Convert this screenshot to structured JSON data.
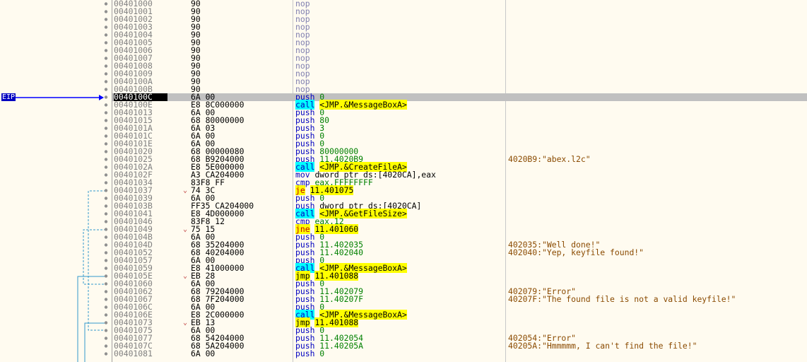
{
  "eip_label": "EIP",
  "rows": [
    {
      "addr": "00401000",
      "bytes": "90",
      "mn": "nop",
      "op": "",
      "cmt": ""
    },
    {
      "addr": "00401001",
      "bytes": "90",
      "mn": "nop",
      "op": "",
      "cmt": ""
    },
    {
      "addr": "00401002",
      "bytes": "90",
      "mn": "nop",
      "op": "",
      "cmt": ""
    },
    {
      "addr": "00401003",
      "bytes": "90",
      "mn": "nop",
      "op": "",
      "cmt": ""
    },
    {
      "addr": "00401004",
      "bytes": "90",
      "mn": "nop",
      "op": "",
      "cmt": ""
    },
    {
      "addr": "00401005",
      "bytes": "90",
      "mn": "nop",
      "op": "",
      "cmt": ""
    },
    {
      "addr": "00401006",
      "bytes": "90",
      "mn": "nop",
      "op": "",
      "cmt": ""
    },
    {
      "addr": "00401007",
      "bytes": "90",
      "mn": "nop",
      "op": "",
      "cmt": ""
    },
    {
      "addr": "00401008",
      "bytes": "90",
      "mn": "nop",
      "op": "",
      "cmt": ""
    },
    {
      "addr": "00401009",
      "bytes": "90",
      "mn": "nop",
      "op": "",
      "cmt": ""
    },
    {
      "addr": "0040100A",
      "bytes": "90",
      "mn": "nop",
      "op": "",
      "cmt": ""
    },
    {
      "addr": "0040100B",
      "bytes": "90",
      "mn": "nop",
      "op": "",
      "cmt": ""
    },
    {
      "addr": "0040100C",
      "bytes": "6A 00",
      "mn": "push",
      "op": "0",
      "cmt": "",
      "eip": true
    },
    {
      "addr": "0040100E",
      "bytes": "E8 8C000000",
      "mn": "call",
      "op": "<JMP.&MessageBoxA>",
      "cmt": "",
      "kind": "call"
    },
    {
      "addr": "00401013",
      "bytes": "6A 00",
      "mn": "push",
      "op": "0",
      "cmt": ""
    },
    {
      "addr": "00401015",
      "bytes": "68 80000000",
      "mn": "push",
      "op": "80",
      "cmt": ""
    },
    {
      "addr": "0040101A",
      "bytes": "6A 03",
      "mn": "push",
      "op": "3",
      "cmt": ""
    },
    {
      "addr": "0040101C",
      "bytes": "6A 00",
      "mn": "push",
      "op": "0",
      "cmt": ""
    },
    {
      "addr": "0040101E",
      "bytes": "6A 00",
      "mn": "push",
      "op": "0",
      "cmt": ""
    },
    {
      "addr": "00401020",
      "bytes": "68 00000080",
      "mn": "push",
      "op": "80000000",
      "cmt": ""
    },
    {
      "addr": "00401025",
      "bytes": "68 B9204000",
      "mn": "push",
      "op": "11.4020B9",
      "cmt": "4020B9:\"abex.l2c\""
    },
    {
      "addr": "0040102A",
      "bytes": "E8 5E000000",
      "mn": "call",
      "op": "<JMP.&CreateFileA>",
      "cmt": "",
      "kind": "call"
    },
    {
      "addr": "0040102F",
      "bytes": "A3 CA204000",
      "mn": "mov",
      "op": "dword ptr ds:[4020CA],eax",
      "cmt": "",
      "kind": "mov"
    },
    {
      "addr": "00401034",
      "bytes": "83F8 FF",
      "mn": "cmp",
      "op": "eax,FFFFFFFF",
      "cmt": ""
    },
    {
      "addr": "00401037",
      "bytes": "74 3C",
      "mn": "je",
      "op": "11.401075",
      "cmt": "",
      "kind": "jcc",
      "arrow": "⌄"
    },
    {
      "addr": "00401039",
      "bytes": "6A 00",
      "mn": "push",
      "op": "0",
      "cmt": ""
    },
    {
      "addr": "0040103B",
      "bytes": "FF35 CA204000",
      "mn": "push",
      "op": "dword ptr ds:[4020CA]",
      "cmt": "",
      "kind": "mem"
    },
    {
      "addr": "00401041",
      "bytes": "E8 4D000000",
      "mn": "call",
      "op": "<JMP.&GetFileSize>",
      "cmt": "",
      "kind": "call"
    },
    {
      "addr": "00401046",
      "bytes": "83F8 12",
      "mn": "cmp",
      "op": "eax,12",
      "cmt": ""
    },
    {
      "addr": "00401049",
      "bytes": "75 15",
      "mn": "jne",
      "op": "11.401060",
      "cmt": "",
      "kind": "jcc",
      "arrow": "⌄"
    },
    {
      "addr": "0040104B",
      "bytes": "6A 00",
      "mn": "push",
      "op": "0",
      "cmt": ""
    },
    {
      "addr": "0040104D",
      "bytes": "68 35204000",
      "mn": "push",
      "op": "11.402035",
      "cmt": "402035:\"Well done!\""
    },
    {
      "addr": "00401052",
      "bytes": "68 40204000",
      "mn": "push",
      "op": "11.402040",
      "cmt": "402040:\"Yep, keyfile found!\""
    },
    {
      "addr": "00401057",
      "bytes": "6A 00",
      "mn": "push",
      "op": "0",
      "cmt": ""
    },
    {
      "addr": "00401059",
      "bytes": "E8 41000000",
      "mn": "call",
      "op": "<JMP.&MessageBoxA>",
      "cmt": "",
      "kind": "call"
    },
    {
      "addr": "0040105E",
      "bytes": "EB 28",
      "mn": "jmp",
      "op": "11.401088",
      "cmt": "",
      "kind": "jmp",
      "arrow": "⌄"
    },
    {
      "addr": "00401060",
      "bytes": "6A 00",
      "mn": "push",
      "op": "0",
      "cmt": ""
    },
    {
      "addr": "00401062",
      "bytes": "68 79204000",
      "mn": "push",
      "op": "11.402079",
      "cmt": "402079:\"Error\""
    },
    {
      "addr": "00401067",
      "bytes": "68 7F204000",
      "mn": "push",
      "op": "11.40207F",
      "cmt": "40207F:\"The found file is not a valid keyfile!\""
    },
    {
      "addr": "0040106C",
      "bytes": "6A 00",
      "mn": "push",
      "op": "0",
      "cmt": ""
    },
    {
      "addr": "0040106E",
      "bytes": "E8 2C000000",
      "mn": "call",
      "op": "<JMP.&MessageBoxA>",
      "cmt": "",
      "kind": "call"
    },
    {
      "addr": "00401073",
      "bytes": "EB 13",
      "mn": "jmp",
      "op": "11.401088",
      "cmt": "",
      "kind": "jmp",
      "arrow": "⌄"
    },
    {
      "addr": "00401075",
      "bytes": "6A 00",
      "mn": "push",
      "op": "0",
      "cmt": ""
    },
    {
      "addr": "00401077",
      "bytes": "68 54204000",
      "mn": "push",
      "op": "11.402054",
      "cmt": "402054:\"Error\""
    },
    {
      "addr": "0040107C",
      "bytes": "68 5A204000",
      "mn": "push",
      "op": "11.40205A",
      "cmt": "40205A:\"Hmmmmm, I can't find the file!\""
    },
    {
      "addr": "00401081",
      "bytes": "6A 00",
      "mn": "push",
      "op": "0",
      "cmt": ""
    }
  ],
  "colors": {
    "background": "#fffbf0",
    "eip_row": "#c0c0c0",
    "call_highlight": "#00ffff",
    "jump_highlight": "#ffff00",
    "eip_arrow": "#0000ff",
    "jump_lines": "#3399cc"
  }
}
